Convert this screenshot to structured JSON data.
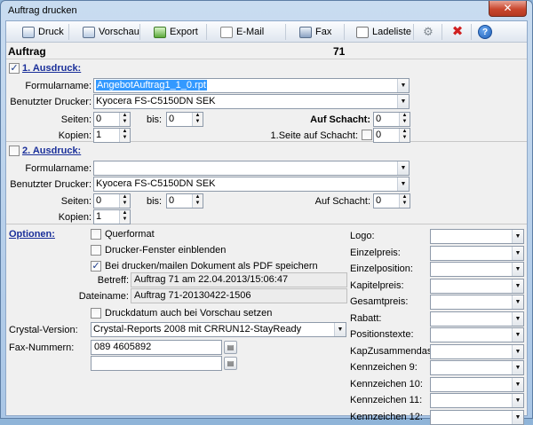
{
  "window": {
    "title": "Auftrag drucken",
    "close": "✕"
  },
  "toolbar": {
    "druck": "Druck",
    "vorschau": "Vorschau",
    "export": "Export",
    "email": "E-Mail",
    "fax": "Fax",
    "ladeliste": "Ladeliste",
    "settings_icon": "⚙",
    "cancel_icon": "✖",
    "help_icon": "?"
  },
  "header": {
    "label": "Auftrag",
    "number": "71"
  },
  "print1": {
    "title": "1. Ausdruck:",
    "checked": true,
    "formular_label": "Formularname:",
    "formular_value": "AngebotAuftrag1_1_0.rpt",
    "drucker_label": "Benutzter Drucker:",
    "drucker_value": "Kyocera FS-C5150DN SEK",
    "seiten_label": "Seiten:",
    "seiten_von": "0",
    "bis_label": "bis:",
    "bis_value": "0",
    "schacht_label": "Auf Schacht:",
    "schacht_value": "0",
    "kopien_label": "Kopien:",
    "kopien_value": "1",
    "first_schacht_label": "1.Seite auf Schacht:",
    "first_schacht_value": "0"
  },
  "print2": {
    "title": "2. Ausdruck:",
    "checked": false,
    "formular_label": "Formularname:",
    "formular_value": "",
    "drucker_label": "Benutzter Drucker:",
    "drucker_value": "Kyocera FS-C5150DN SEK",
    "seiten_label": "Seiten:",
    "seiten_von": "0",
    "bis_label": "bis:",
    "bis_value": "0",
    "schacht_label": "Auf Schacht:",
    "schacht_value": "0",
    "kopien_label": "Kopien:",
    "kopien_value": "1"
  },
  "options": {
    "title": "Optionen:",
    "querformat": "Querformat",
    "drucker_fenster": "Drucker-Fenster einblenden",
    "pdf_speichern": "Bei drucken/mailen Dokument als PDF speichern",
    "betreff_label": "Betreff:",
    "betreff_value": "Auftrag 71 am 22.04.2013/15:06:47",
    "dateiname_label": "Dateiname:",
    "dateiname_value": "Auftrag 71-20130422-1506",
    "druckdatum": "Druckdatum auch bei Vorschau setzen",
    "crystal_label": "Crystal-Version:",
    "crystal_value": "Crystal-Reports 2008 mit CRRUN12-StayReady",
    "fax_label": "Fax-Nummern:",
    "fax_value1": "089 4605892",
    "fax_value2": ""
  },
  "right_fields": [
    "Logo:",
    "Einzelpreis:",
    "Einzelposition:",
    "Kapitelpreis:",
    "Gesamtpreis:",
    "Rabatt:",
    "Positionstexte:",
    "KapZusammendassung",
    "Kennzeichen 9:",
    "Kennzeichen 10:",
    "Kennzeichen 11:",
    "Kennzeichen 12:"
  ]
}
